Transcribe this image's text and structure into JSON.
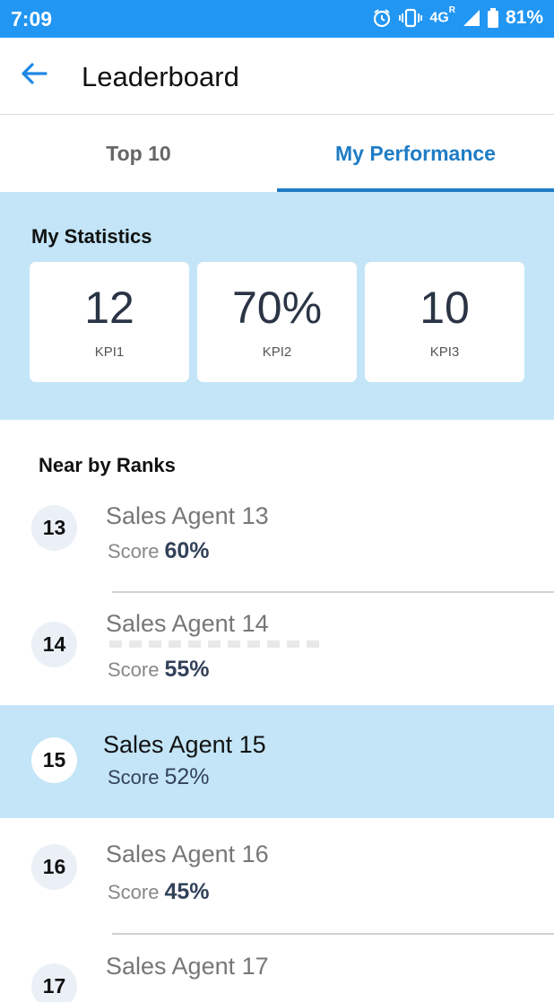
{
  "status_bar": {
    "time": "7:09",
    "network": "4G",
    "roaming": "R",
    "battery": "81%",
    "icons": [
      "alarm-icon",
      "vibrate-icon",
      "signal-icon",
      "battery-icon"
    ]
  },
  "app_bar": {
    "title": "Leaderboard",
    "back_icon": "arrow-left-icon"
  },
  "tabs": [
    {
      "label": "Top 10",
      "active": false
    },
    {
      "label": "My Performance",
      "active": true
    }
  ],
  "stats": {
    "title": "My Statistics",
    "kpis": [
      {
        "value": "12",
        "label": "KPI1"
      },
      {
        "value": "70%",
        "label": "KPI2"
      },
      {
        "value": "10",
        "label": "KPI3"
      }
    ]
  },
  "near_ranks": {
    "title": "Near by Ranks",
    "items": [
      {
        "rank": "13",
        "name": "Sales Agent 13",
        "score_label": "Score",
        "score": "60%",
        "highlighted": false
      },
      {
        "rank": "14",
        "name": "Sales Agent 14",
        "score_label": "Score",
        "score": "55%",
        "highlighted": false
      },
      {
        "rank": "15",
        "name": "Sales Agent 15",
        "score_label": "Score",
        "score": "52%",
        "highlighted": true
      },
      {
        "rank": "16",
        "name": "Sales Agent 16",
        "score_label": "Score",
        "score": "45%",
        "highlighted": false
      },
      {
        "rank": "17",
        "name": "Sales Agent 17",
        "score_label": "Score",
        "score": "",
        "highlighted": false
      }
    ]
  },
  "colors": {
    "status_bar": "#2196f3",
    "accent": "#1e7cc5",
    "highlight": "#c3e5f7",
    "score_text": "#33425a"
  }
}
